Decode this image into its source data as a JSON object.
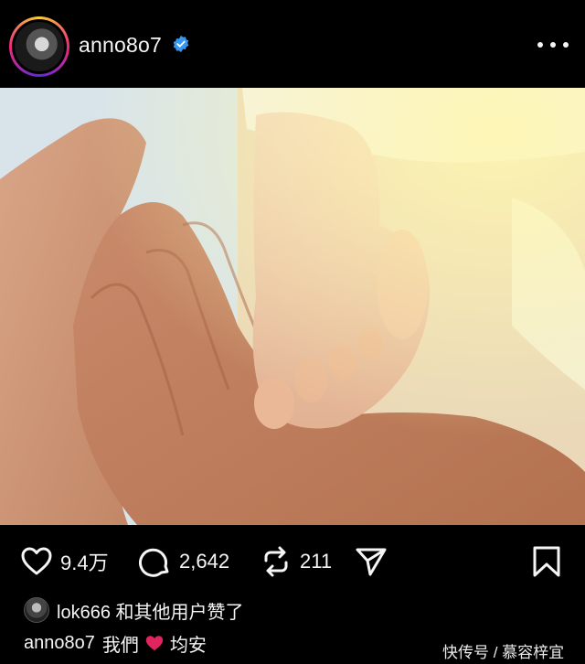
{
  "header": {
    "username": "anno8o7",
    "verified_icon": "verified-badge-icon",
    "more_icon": "more-options-icon"
  },
  "post": {
    "image_icon": "photo-hands-baby-foot"
  },
  "actions": {
    "like_count": "9.4万",
    "comment_count": "2,642",
    "repost_count": "211",
    "icons": [
      "heart-icon",
      "comment-icon",
      "repost-icon",
      "share-icon",
      "bookmark-icon"
    ]
  },
  "likes": {
    "text": "lok666 和其他用户赞了"
  },
  "caption": {
    "username": "anno8o7",
    "text_before": "我們",
    "text_after": "均安"
  },
  "watermark": {
    "text": "快传号 / 慕容梓宜"
  },
  "colors": {
    "background": "#000000",
    "verified": "#3897f0",
    "heart_emoji": "#e0245e"
  }
}
